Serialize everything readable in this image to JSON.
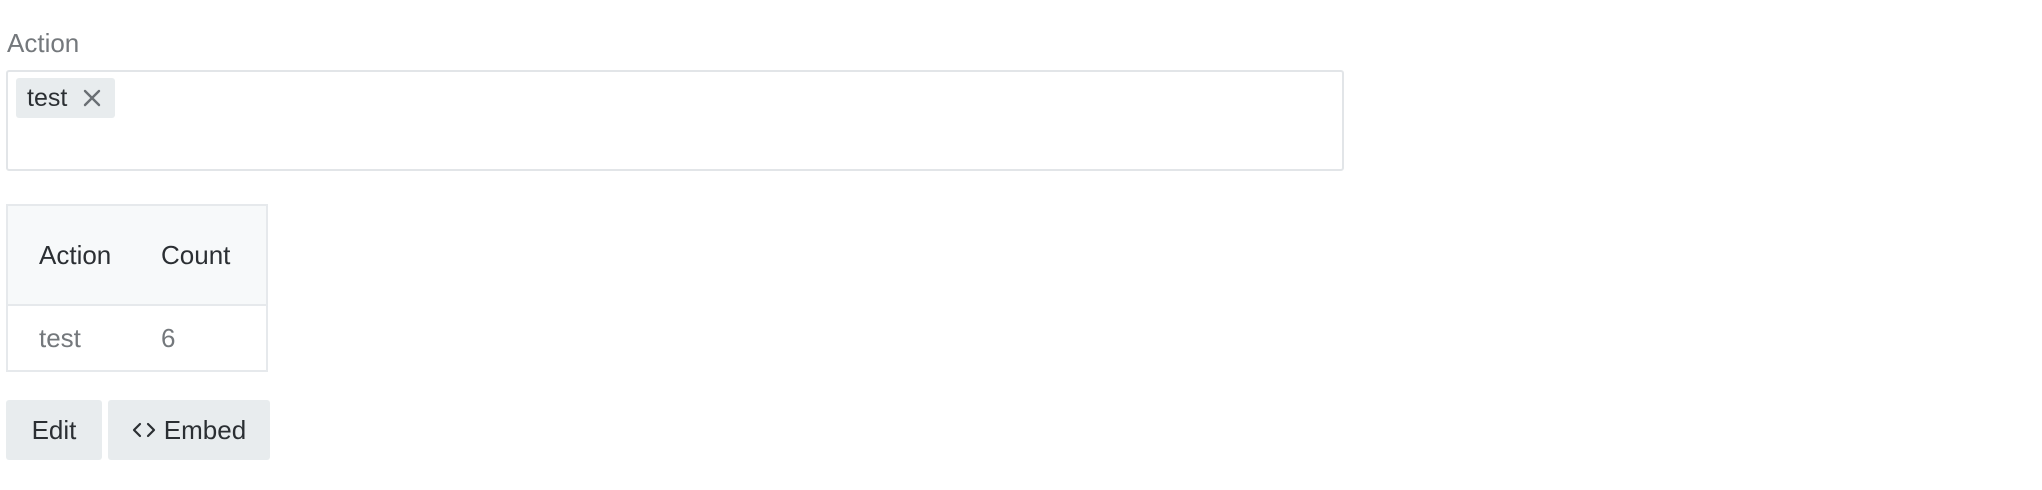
{
  "filter": {
    "label": "Action",
    "tags": [
      {
        "label": "test",
        "remove_icon": "close-icon"
      }
    ]
  },
  "table": {
    "columns": [
      "Action",
      "Count"
    ],
    "rows": [
      [
        "test",
        "6"
      ]
    ]
  },
  "actions": {
    "edit_label": "Edit",
    "embed_label": "Embed",
    "embed_icon": "code-icon"
  },
  "colors": {
    "tag_bg": "#e8ecee",
    "button_bg": "#e8ecee",
    "header_bg": "#f7f9fa",
    "border": "#e2e5e8",
    "muted_text": "#74787c"
  }
}
